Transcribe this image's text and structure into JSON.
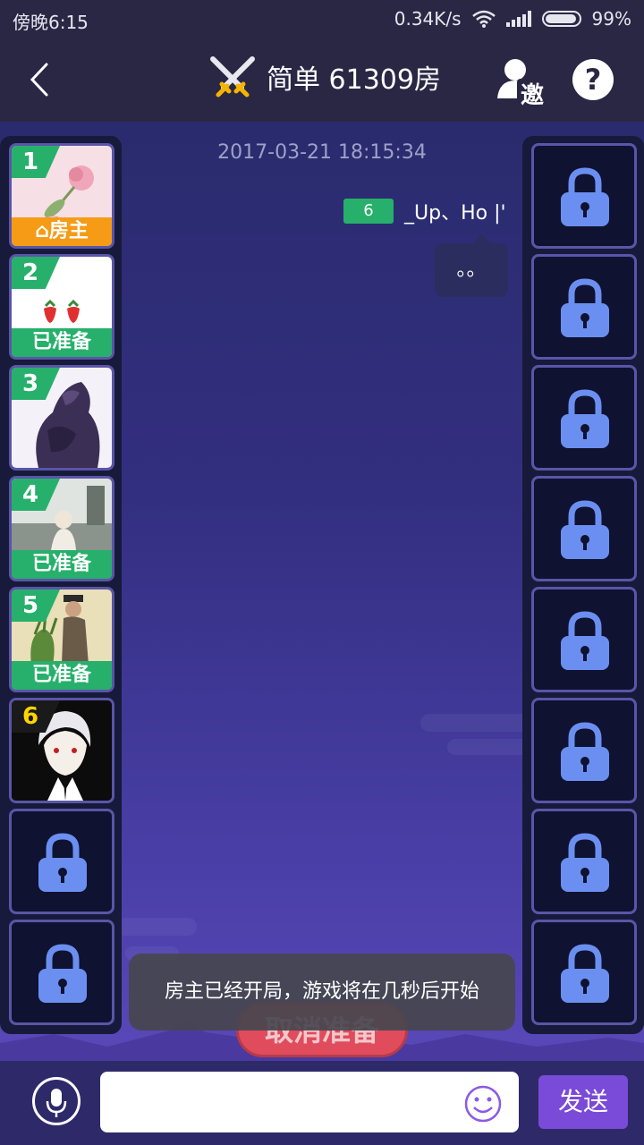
{
  "status_bar": {
    "time": "傍晚6:15",
    "net_speed": "0.34K/s",
    "battery": "99%",
    "icons": [
      "wifi-icon",
      "signal-icon",
      "battery-icon"
    ]
  },
  "header": {
    "title": "简单 61309房",
    "back_icon": "back-arrow-icon",
    "room_icon": "crossed-swords-icon",
    "invite_label": "邀",
    "help_label": "?"
  },
  "chat": {
    "timestamp": "2017-03-21 18:15:34",
    "message": {
      "level": "6",
      "name": "_Up、Ho |'",
      "text": "。。"
    }
  },
  "left_slots": [
    {
      "number": "1",
      "badge": "房主",
      "badge_type": "host",
      "avatar": "rose-avatar"
    },
    {
      "number": "2",
      "badge": "已准备",
      "badge_type": "ready",
      "avatar": "strawberry-avatar"
    },
    {
      "number": "3",
      "badge": "",
      "badge_type": "",
      "avatar": "werewolf-avatar"
    },
    {
      "number": "4",
      "badge": "已准备",
      "badge_type": "ready",
      "avatar": "photo-avatar"
    },
    {
      "number": "5",
      "badge": "已准备",
      "badge_type": "ready",
      "avatar": "couple-avatar"
    },
    {
      "number": "6",
      "badge": "",
      "badge_type": "",
      "avatar": "anime-avatar"
    },
    {
      "locked": true
    },
    {
      "locked": true
    }
  ],
  "right_slots_locked_count": 8,
  "cancel_button": "取消准备",
  "toast": "房主已经开局，游戏将在几秒后开始",
  "input": {
    "value": "",
    "placeholder": ""
  },
  "send_label": "发送",
  "colors": {
    "ready_green": "#27b06b",
    "host_orange": "#f59b16",
    "lock_blue": "#6b8ff0",
    "send_purple": "#7a4ad8"
  }
}
